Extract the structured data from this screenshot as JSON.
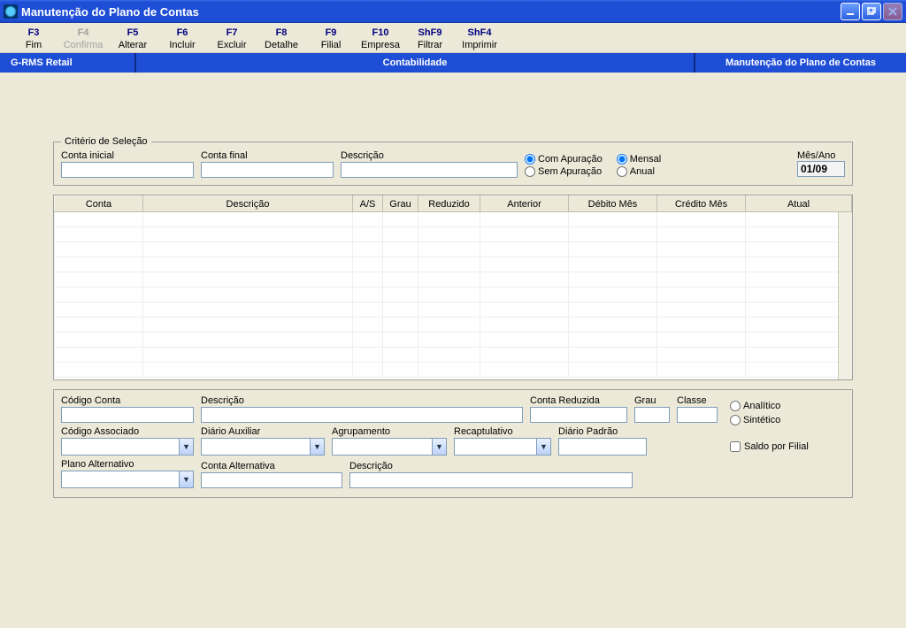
{
  "window": {
    "title": "Manutenção do Plano de Contas"
  },
  "menu": [
    {
      "key": "F3",
      "label": "Fim",
      "disabled": false
    },
    {
      "key": "F4",
      "label": "Confirma",
      "disabled": true
    },
    {
      "key": "F5",
      "label": "Alterar",
      "disabled": false
    },
    {
      "key": "F6",
      "label": "Incluir",
      "disabled": false
    },
    {
      "key": "F7",
      "label": "Excluir",
      "disabled": false
    },
    {
      "key": "F8",
      "label": "Detalhe",
      "disabled": false
    },
    {
      "key": "F9",
      "label": "Filial",
      "disabled": false
    },
    {
      "key": "F10",
      "label": "Empresa",
      "disabled": false
    },
    {
      "key": "ShF9",
      "label": "Filtrar",
      "disabled": false
    },
    {
      "key": "ShF4",
      "label": "Imprimir",
      "disabled": false
    }
  ],
  "infobar": {
    "left": "G-RMS Retail",
    "center": "Contabilidade",
    "right": "Manutenção do Plano de Contas"
  },
  "criteria": {
    "legend": "Critério de Seleção",
    "conta_inicial": {
      "label": "Conta inicial",
      "value": ""
    },
    "conta_final": {
      "label": "Conta final",
      "value": ""
    },
    "descricao": {
      "label": "Descrição",
      "value": ""
    },
    "apuracao": {
      "com": "Com Apuração",
      "sem": "Sem Apuração",
      "selected": "com"
    },
    "periodo": {
      "mensal": "Mensal",
      "anual": "Anual",
      "selected": "mensal"
    },
    "mes_ano": {
      "label": "Mês/Ano",
      "value": "01/09"
    }
  },
  "grid": {
    "columns": [
      "Conta",
      "Descrição",
      "A/S",
      "Grau",
      "Reduzido",
      "Anterior",
      "Débito Mês",
      "Crédito Mês",
      "Atual"
    ],
    "rows": []
  },
  "details": {
    "codigo_conta": {
      "label": "Código Conta",
      "value": ""
    },
    "descricao": {
      "label": "Descrição",
      "value": ""
    },
    "conta_reduzida": {
      "label": "Conta Reduzida",
      "value": ""
    },
    "grau": {
      "label": "Grau",
      "value": ""
    },
    "classe": {
      "label": "Classe",
      "value": ""
    },
    "codigo_associado": {
      "label": "Código Associado",
      "value": ""
    },
    "diario_auxiliar": {
      "label": "Diário Auxiliar",
      "value": ""
    },
    "agrupamento": {
      "label": "Agrupamento",
      "value": ""
    },
    "recapitulativo": {
      "label": "Recaptulativo",
      "value": ""
    },
    "diario_padrao": {
      "label": "Diário Padrão",
      "value": ""
    },
    "plano_alternativo": {
      "label": "Plano Alternativo",
      "value": ""
    },
    "conta_alternativa": {
      "label": "Conta Alternativa",
      "value": ""
    },
    "descricao_alt": {
      "label": "Descrição",
      "value": ""
    },
    "tipo": {
      "analitico": "Analítico",
      "sintetico": "Sintético",
      "selected": ""
    },
    "saldo_filial": {
      "label": "Saldo por Filial",
      "checked": false
    }
  }
}
